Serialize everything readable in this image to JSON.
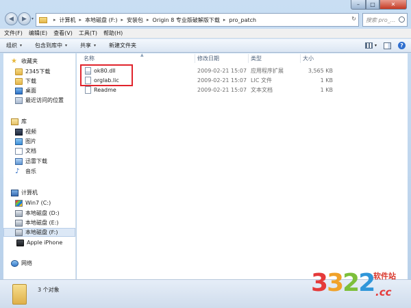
{
  "window_controls": {
    "minimize": "–",
    "maximize": "□",
    "close": "✕"
  },
  "address": {
    "crumbs": [
      "计算机",
      "本地磁盘 (F:)",
      "安装包",
      "Origin 8 专业版破解版下载",
      "pro_patch"
    ],
    "separator": "▸",
    "dropdown": "▾",
    "refresh": "↻"
  },
  "search": {
    "placeholder": "搜索 pro_..."
  },
  "menu": {
    "items": [
      "文件(F)",
      "编辑(E)",
      "查看(V)",
      "工具(T)",
      "帮助(H)"
    ]
  },
  "toolbar": {
    "organize": "组织",
    "include_library": "包含到库中",
    "share": "共享",
    "new_folder": "新建文件夹",
    "caret": "▾",
    "help": "?"
  },
  "nav": {
    "favorites_header": "收藏夹",
    "favorites": [
      "2345下载",
      "下载",
      "桌面",
      "最近访问的位置"
    ],
    "libraries_header": "库",
    "libraries": [
      "视频",
      "图片",
      "文档",
      "迅雷下载",
      "音乐"
    ],
    "computer_header": "计算机",
    "drives": [
      "Win7 (C:)",
      "本地磁盘 (D:)",
      "本地磁盘 (E:)",
      "本地磁盘 (F:)"
    ],
    "device": "Apple iPhone",
    "network": "网络"
  },
  "columns": {
    "name": "名称",
    "modified": "修改日期",
    "type": "类型",
    "size": "大小",
    "sort_caret": "▲"
  },
  "files": [
    {
      "name": "ok80.dll",
      "modified": "2009-02-21 15:07",
      "type": "应用程序扩展",
      "size": "3,565 KB",
      "icon": "dll-file-icon"
    },
    {
      "name": "orglab.lic",
      "modified": "2009-02-21 15:07",
      "type": "LIC 文件",
      "size": "1 KB",
      "icon": "file-icon"
    },
    {
      "name": "Readme",
      "modified": "2009-02-21 15:07",
      "type": "文本文档",
      "size": "1 KB",
      "icon": "text-file-icon"
    }
  ],
  "status": {
    "count_text": "3 个对象"
  },
  "watermark": {
    "digits": [
      "3",
      "3",
      "2",
      "2"
    ],
    "cn": "软件站",
    "domain": ".cc"
  }
}
